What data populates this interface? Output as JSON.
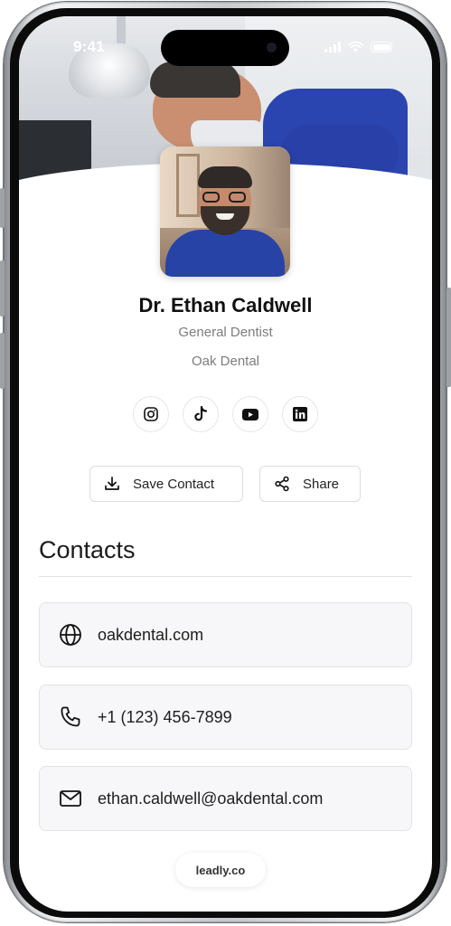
{
  "status_bar": {
    "time": "9:41"
  },
  "profile": {
    "name": "Dr. Ethan Caldwell",
    "role": "General Dentist",
    "company": "Oak Dental"
  },
  "socials": [
    {
      "icon": "instagram-icon"
    },
    {
      "icon": "tiktok-icon"
    },
    {
      "icon": "youtube-icon"
    },
    {
      "icon": "linkedin-icon"
    }
  ],
  "actions": {
    "save_label": "Save Contact",
    "share_label": "Share"
  },
  "contacts": {
    "title": "Contacts",
    "items": [
      {
        "icon": "globe-icon",
        "value": "oakdental.com"
      },
      {
        "icon": "phone-icon",
        "value": "+1 (123) 456-7899"
      },
      {
        "icon": "mail-icon",
        "value": "ethan.caldwell@oakdental.com"
      }
    ]
  },
  "footer": {
    "brand": "leadly.co"
  },
  "colors": {
    "text": "#111111",
    "muted": "#7d7d7d",
    "card_bg": "#f7f7f9",
    "scrub_blue": "#2843a6"
  }
}
